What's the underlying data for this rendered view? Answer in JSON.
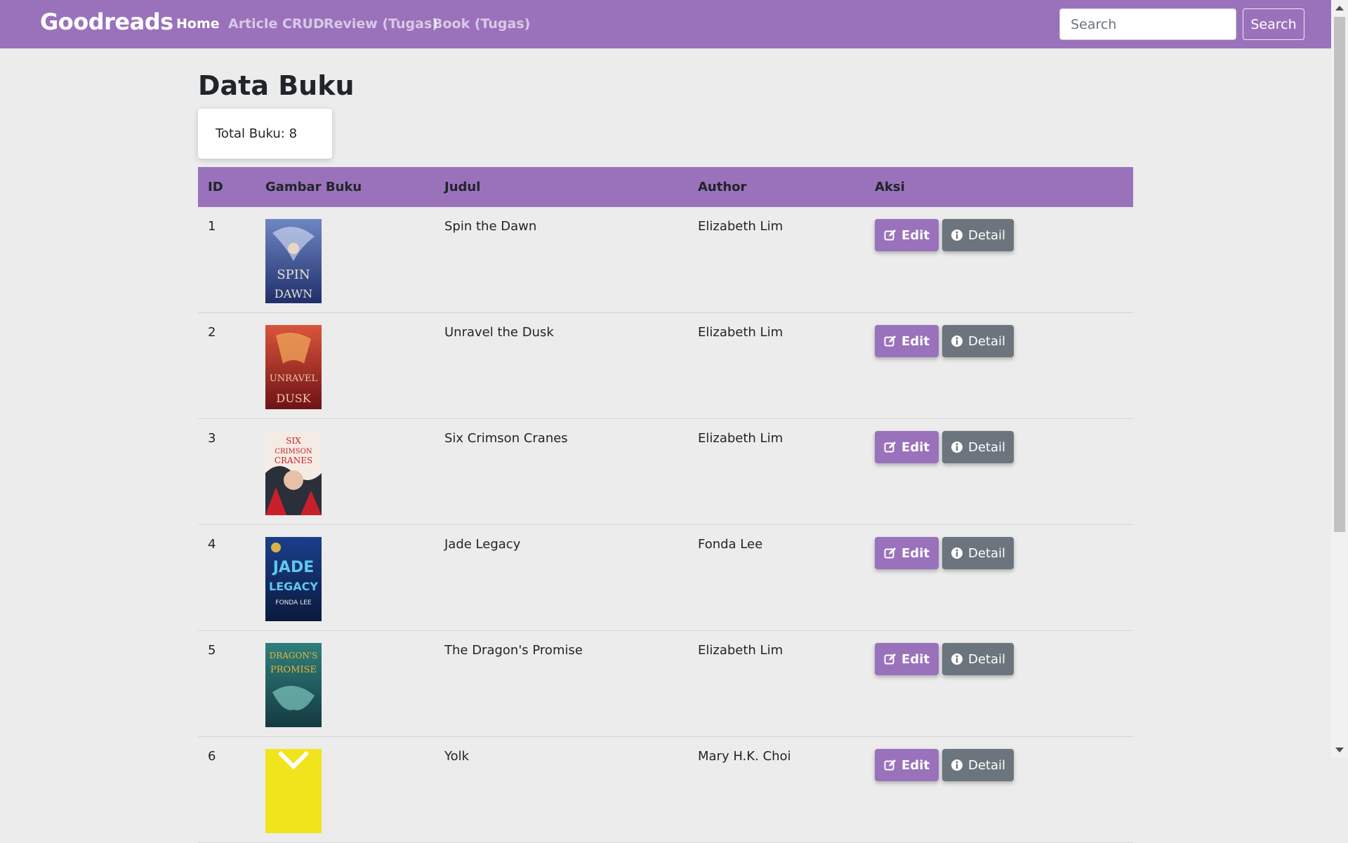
{
  "navbar": {
    "brand": "Goodreads",
    "links": [
      "Home",
      "Article CRUD",
      "Review (Tugas)",
      "Book (Tugas)"
    ],
    "search_placeholder": "Search",
    "search_button": "Search"
  },
  "page": {
    "title": "Data Buku",
    "total_label": "Total Buku: 8"
  },
  "table": {
    "headers": [
      "ID",
      "Gambar Buku",
      "Judul",
      "Author",
      "Aksi"
    ],
    "edit_label": "Edit",
    "detail_label": "Detail",
    "rows": [
      {
        "id": "1",
        "title": "Spin the Dawn",
        "author": "Elizabeth Lim"
      },
      {
        "id": "2",
        "title": "Unravel the Dusk",
        "author": "Elizabeth Lim"
      },
      {
        "id": "3",
        "title": "Six Crimson Cranes",
        "author": "Elizabeth Lim"
      },
      {
        "id": "4",
        "title": "Jade Legacy",
        "author": "Fonda Lee"
      },
      {
        "id": "5",
        "title": "The Dragon's Promise",
        "author": "Elizabeth Lim"
      },
      {
        "id": "6",
        "title": "Yolk",
        "author": "Mary H.K. Choi"
      }
    ]
  },
  "colors": {
    "primary": "#9a72bb",
    "secondary": "#6c757d",
    "background": "#ececec"
  }
}
